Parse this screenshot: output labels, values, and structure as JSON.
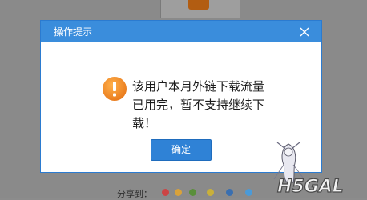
{
  "dialog": {
    "title": "操作提示",
    "message": "该用户本月外链下载流量\n已用完，暂不支持继续下\n载！",
    "ok_label": "确定",
    "close_icon": "close-icon",
    "warning_icon": "warning-icon"
  },
  "background": {
    "footer_text": "分享到："
  },
  "watermark": {
    "text": "H5GAL"
  },
  "colors": {
    "header": "#3a8ddc",
    "button": "#2f82d6",
    "warning": "#f08a24",
    "overlay": "#8a8a8a"
  }
}
